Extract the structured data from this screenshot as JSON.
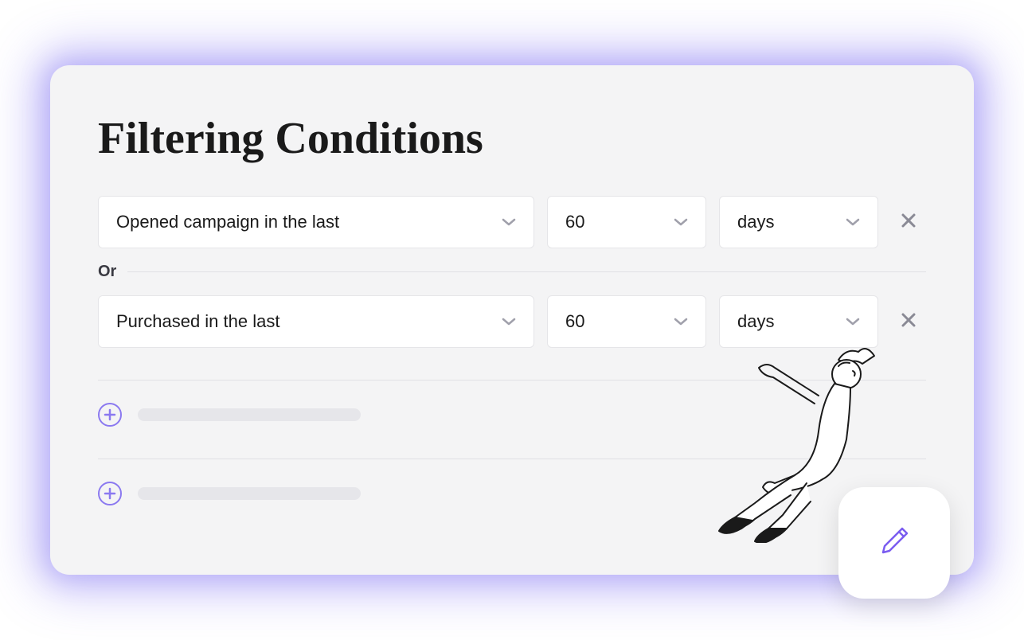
{
  "title": "Filtering Conditions",
  "conditions": [
    {
      "type": "Opened campaign in the last",
      "value": "60",
      "unit": "days"
    },
    {
      "type": "Purchased in the last",
      "value": "60",
      "unit": "days"
    }
  ],
  "operator": "Or",
  "colors": {
    "accent": "#7a5cf0",
    "glow": "#6a5af0"
  }
}
